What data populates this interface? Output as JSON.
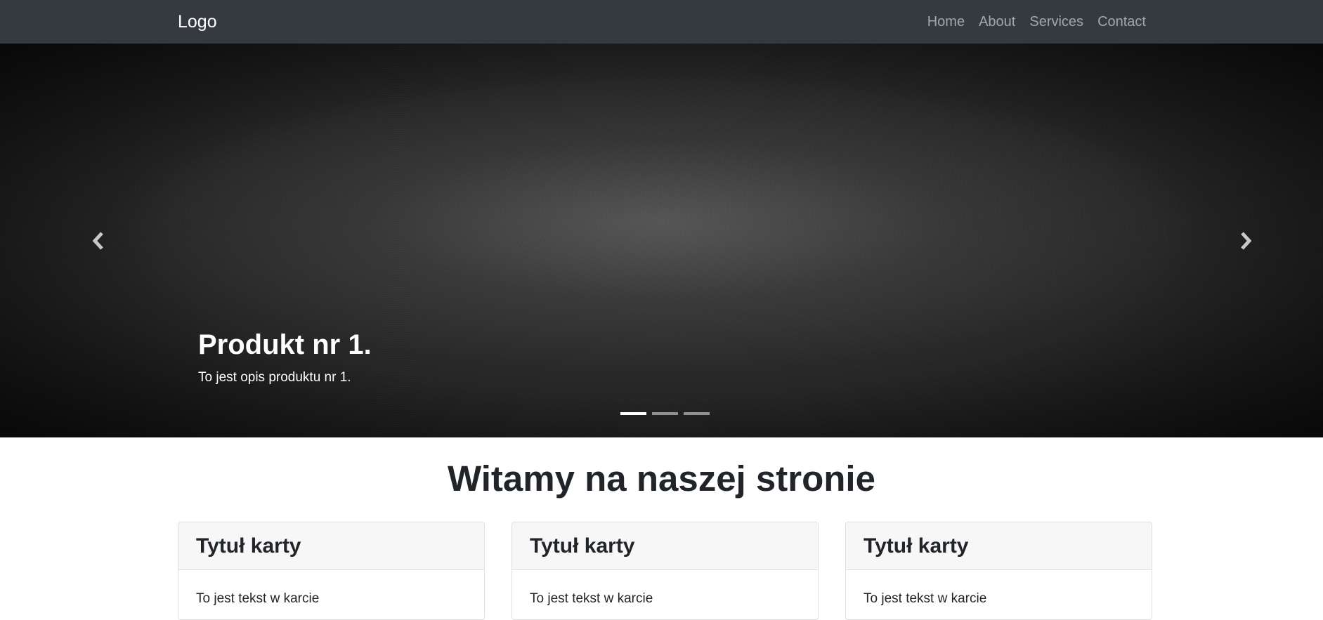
{
  "navbar": {
    "brand": "Logo",
    "links": [
      "Home",
      "About",
      "Services",
      "Contact"
    ]
  },
  "carousel": {
    "slide_title": "Produkt nr 1.",
    "slide_text": "To jest opis produktu nr 1.",
    "indicator_count": 3,
    "active_index": 0
  },
  "main": {
    "heading": "Witamy na naszej stronie",
    "cards": [
      {
        "title": "Tytuł karty",
        "text": "To jest tekst w karcie"
      },
      {
        "title": "Tytuł karty",
        "text": "To jest tekst w karcie"
      },
      {
        "title": "Tytuł karty",
        "text": "To jest tekst w karcie"
      }
    ]
  },
  "icons": {
    "prev": "chevron-left-icon",
    "next": "chevron-right-icon"
  },
  "colors": {
    "navbar_bg": "#343a40",
    "nav_link": "rgba(255,255,255,0.55)",
    "text_dark": "#212529"
  }
}
